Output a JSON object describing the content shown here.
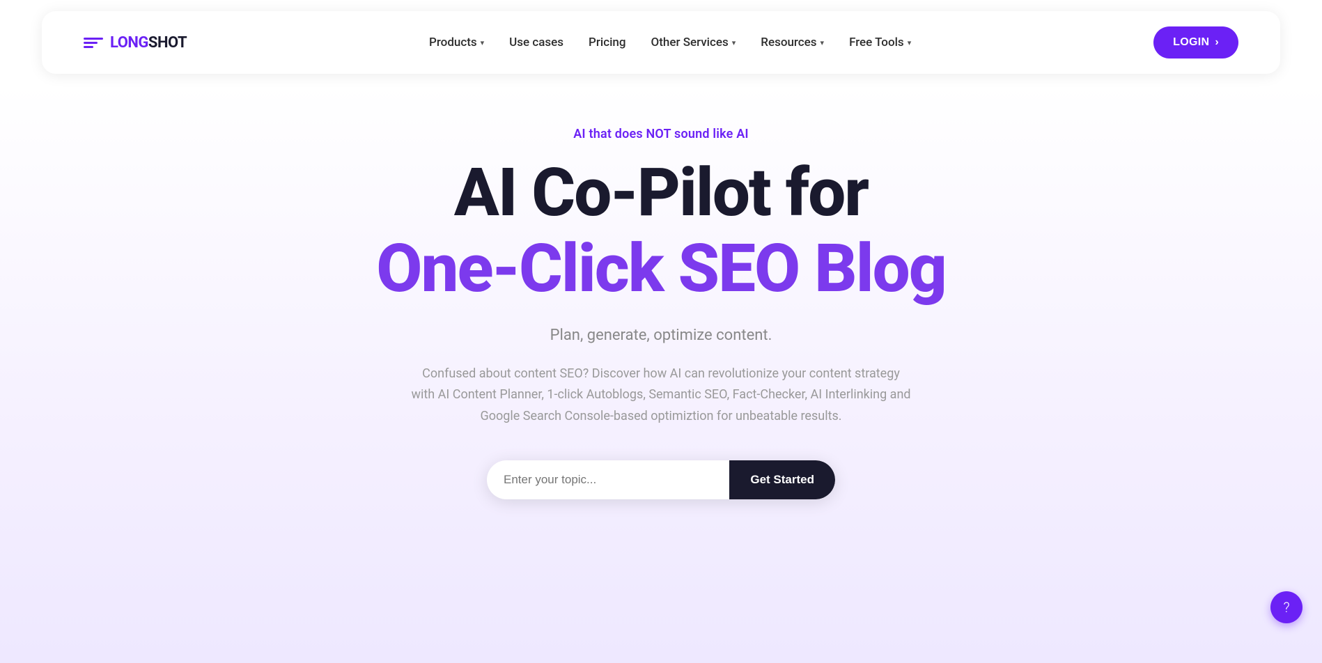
{
  "navbar": {
    "logo": {
      "long": "LONG",
      "shot": "SHOT"
    },
    "nav_items": [
      {
        "label": "Products",
        "has_dropdown": true
      },
      {
        "label": "Use cases",
        "has_dropdown": false
      },
      {
        "label": "Pricing",
        "has_dropdown": false
      },
      {
        "label": "Other Services",
        "has_dropdown": true
      },
      {
        "label": "Resources",
        "has_dropdown": true
      },
      {
        "label": "Free Tools",
        "has_dropdown": true
      }
    ],
    "login_label": "LOGIN",
    "login_arrow": "›"
  },
  "hero": {
    "tagline": "AI that does NOT sound like AI",
    "title_line1": "AI Co-Pilot for",
    "title_line2": "One-Click SEO Blog",
    "subtitle": "Plan, generate, optimize content.",
    "description": "Confused about content SEO? Discover how AI can revolutionize your content strategy with AI Content Planner, 1-click Autoblogs,  Semantic SEO, Fact-Checker, AI Interlinking and Google Search Console-based optimiztion for unbeatable results.",
    "cta": {
      "input_placeholder": "Enter your topic...",
      "button_label": "Get Started"
    }
  },
  "help": {
    "icon": "?"
  }
}
